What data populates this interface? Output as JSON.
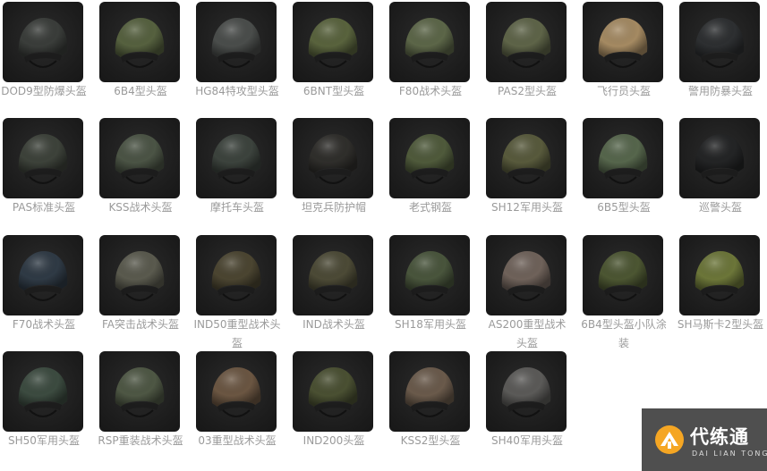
{
  "helmets": [
    {
      "label": "DOD9型防爆头盔",
      "color": "#3a3d3a"
    },
    {
      "label": "6B4型头盔",
      "color": "#56613f"
    },
    {
      "label": "HG84特攻型头盔",
      "color": "#4a4d4b"
    },
    {
      "label": "6BNT型头盔",
      "color": "#59633d"
    },
    {
      "label": "F80战术头盔",
      "color": "#5c6648"
    },
    {
      "label": "PAS2型头盔",
      "color": "#5e6448"
    },
    {
      "label": "飞行员头盔",
      "color": "#a58a62"
    },
    {
      "label": "警用防暴头盔",
      "color": "#2d2f31"
    },
    {
      "label": "PAS标准头盔",
      "color": "#3d423a"
    },
    {
      "label": "KSS战术头盔",
      "color": "#4b5445"
    },
    {
      "label": "摩托车头盔",
      "color": "#3c433d"
    },
    {
      "label": "坦克兵防护帽",
      "color": "#2f2e2b"
    },
    {
      "label": "老式钢盔",
      "color": "#4f5a3b"
    },
    {
      "label": "SH12军用头盔",
      "color": "#585a3c"
    },
    {
      "label": "6B5型头盔",
      "color": "#56664c"
    },
    {
      "label": "巡警头盔",
      "color": "#232425"
    },
    {
      "label": "F70战术头盔",
      "color": "#2f3a45"
    },
    {
      "label": "FA突击战术头盔",
      "color": "#5a5a4e"
    },
    {
      "label": "IND50重型战术头盔",
      "color": "#4b4531"
    },
    {
      "label": "IND战术头盔",
      "color": "#4c4a36"
    },
    {
      "label": "SH18军用头盔",
      "color": "#49553c"
    },
    {
      "label": "AS200重型战术头盔",
      "color": "#6f625a"
    },
    {
      "label": "6B4型头盔小队涂装",
      "color": "#4c5632"
    },
    {
      "label": "SH马斯卡2型头盔",
      "color": "#6c7639"
    },
    {
      "label": "SH50军用头盔",
      "color": "#3c4b40"
    },
    {
      "label": "RSP重装战术头盔",
      "color": "#4e5744"
    },
    {
      "label": "03重型战术头盔",
      "color": "#6b5642"
    },
    {
      "label": "IND200头盔",
      "color": "#4a5032"
    },
    {
      "label": "KSS2型头盔",
      "color": "#6a5a4b"
    },
    {
      "label": "SH40军用头盔",
      "color": "#5b5a58"
    }
  ],
  "watermark": {
    "cn": "代练通",
    "en": "DAI LIAN TONG",
    "accent": "#f5a623"
  }
}
